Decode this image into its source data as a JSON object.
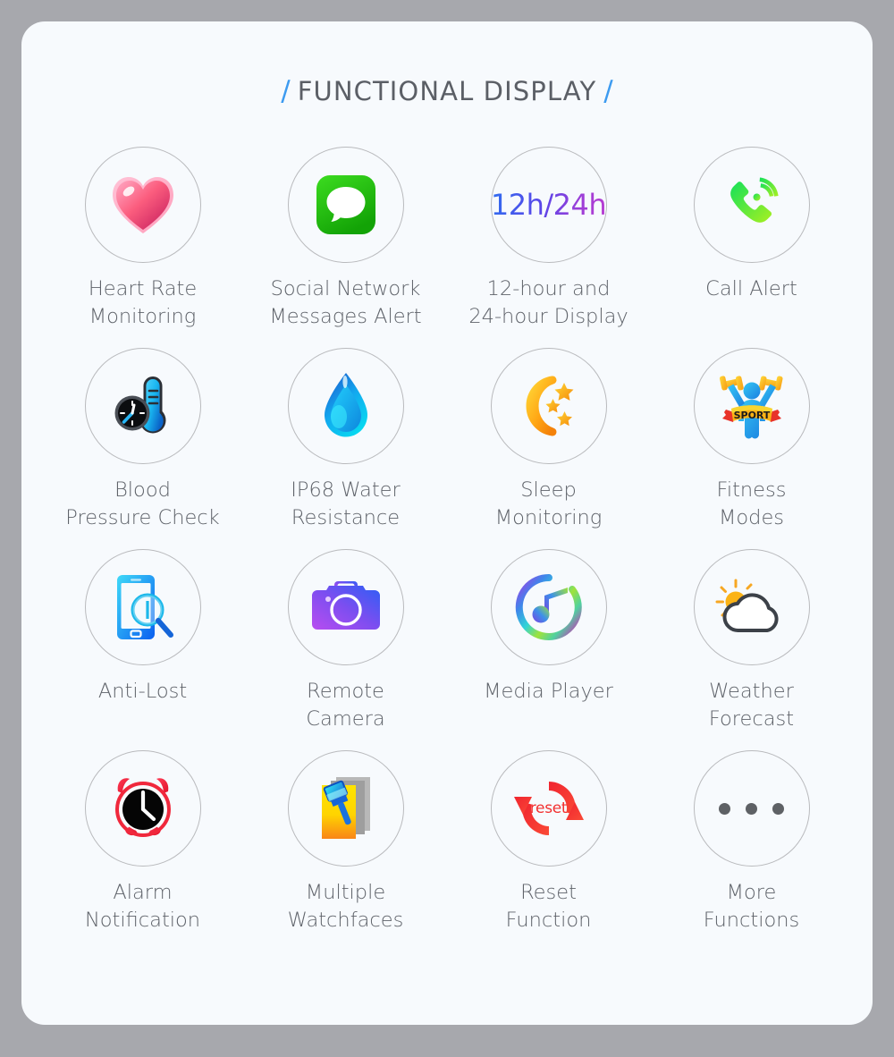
{
  "page": {
    "background_color": "#a7a8ad",
    "card_color": "#f7fafd",
    "accent_color": "#3d9bf0",
    "label_color": "#5f636a",
    "circle_border_color": "#b9babd"
  },
  "header": {
    "slash_left": "/",
    "title": "FUNCTIONAL DISPLAY",
    "slash_right": "/"
  },
  "grid": {
    "columns": 4,
    "rows": 4,
    "items": [
      {
        "id": "heart-rate",
        "icon": "heart-icon",
        "label": "Heart Rate\nMonitoring"
      },
      {
        "id": "social-messages",
        "icon": "message-bubble-icon",
        "label": "Social Network\nMessages Alert"
      },
      {
        "id": "time-format",
        "icon": "12h-24h-text-icon",
        "label": "12-hour and\n24-hour Display",
        "icon_text": "12h/24h"
      },
      {
        "id": "call-alert",
        "icon": "phone-call-icon",
        "label": "Call Alert"
      },
      {
        "id": "blood-pressure",
        "icon": "thermometer-gauge-icon",
        "label": "Blood\nPressure Check"
      },
      {
        "id": "water-resistance",
        "icon": "water-drop-icon",
        "label": "IP68 Water\nResistance"
      },
      {
        "id": "sleep-monitoring",
        "icon": "moon-stars-icon",
        "label": "Sleep\nMonitoring"
      },
      {
        "id": "fitness-modes",
        "icon": "sport-athlete-icon",
        "label": "Fitness\nModes",
        "icon_text": "SPORT"
      },
      {
        "id": "anti-lost",
        "icon": "phone-magnifier-icon",
        "label": "Anti-Lost"
      },
      {
        "id": "remote-camera",
        "icon": "camera-icon",
        "label": "Remote\nCamera"
      },
      {
        "id": "media-player",
        "icon": "music-note-ring-icon",
        "label": "Media Player"
      },
      {
        "id": "weather-forecast",
        "icon": "sun-cloud-icon",
        "label": "Weather\nForecast"
      },
      {
        "id": "alarm-notification",
        "icon": "alarm-clock-icon",
        "label": "Alarm\nNotification"
      },
      {
        "id": "multiple-watchfaces",
        "icon": "watchface-brush-icon",
        "label": "Multiple\nWatchfaces"
      },
      {
        "id": "reset-function",
        "icon": "reset-arrows-icon",
        "label": "Reset\nFunction",
        "icon_text": "reset"
      },
      {
        "id": "more-functions",
        "icon": "ellipsis-icon",
        "label": "More\nFunctions"
      }
    ]
  }
}
